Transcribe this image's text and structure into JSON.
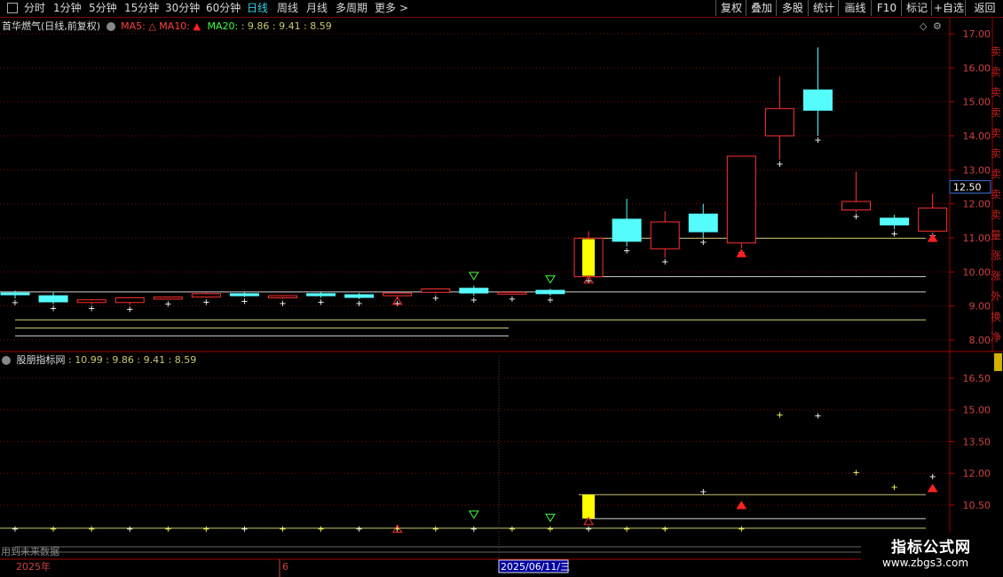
{
  "toolbar": {
    "periods": [
      "分时",
      "1分钟",
      "5分钟",
      "15分钟",
      "30分钟",
      "60分钟",
      "日线",
      "周线",
      "月线",
      "多周期",
      "更多"
    ],
    "active_period": "日线",
    "more_arrow": ">",
    "right_buttons": [
      "复权",
      "叠加",
      "多股",
      "统计",
      "画线",
      "F10",
      "标记",
      "+自选",
      "返回"
    ]
  },
  "main_panel": {
    "stock_title": "首华燃气(日线,前复权)",
    "ma5_label": "MA5:",
    "ma10_label": "MA10:",
    "ma20_label": "MA20:",
    "ma20_values": ": 9.86 : 9.41 : 8.59",
    "price_marker": "12.50",
    "y_ticks": [
      "17.00",
      "16.00",
      "15.00",
      "14.00",
      "13.00",
      "12.00",
      "11.00",
      "10.00",
      "9.00",
      "8.00"
    ],
    "right_strip_text": "卖卖卖卖卖卖卖卖卖量涨涨外换净"
  },
  "sub_panel": {
    "title": "股朋指标网",
    "values": ": 10.99 : 9.86 : 9.41 : 8.59",
    "y_ticks": [
      "16.50",
      "15.00",
      "13.50",
      "12.00",
      "10.50"
    ],
    "note": "用到未来数据"
  },
  "date_axis": {
    "year_label": "2025年",
    "month_label": "6",
    "selected_date": "2025/06/11/三"
  },
  "watermark": {
    "line1": "指标公式网",
    "line2": "www.zbgs3.com"
  },
  "colors": {
    "up": "#ff3030",
    "down": "#54fcfc",
    "highlight": "#ffff00",
    "grid": "#800000",
    "ma_line": "#c8c870",
    "axis_text": "#d04040"
  },
  "chart_data": {
    "type": "candlestick",
    "y_range": [
      7.8,
      17.4
    ],
    "candles": [
      {
        "o": 9.38,
        "c": 9.33,
        "h": 9.45,
        "l": 9.22,
        "dir": "down"
      },
      {
        "o": 9.3,
        "c": 9.12,
        "h": 9.4,
        "l": 9.05,
        "dir": "down"
      },
      {
        "o": 9.1,
        "c": 9.18,
        "h": 9.2,
        "l": 9.05,
        "dir": "up"
      },
      {
        "o": 9.1,
        "c": 9.24,
        "h": 9.26,
        "l": 9.03,
        "dir": "up"
      },
      {
        "o": 9.2,
        "c": 9.26,
        "h": 9.28,
        "l": 9.18,
        "dir": "up"
      },
      {
        "o": 9.26,
        "c": 9.36,
        "h": 9.4,
        "l": 9.24,
        "dir": "up"
      },
      {
        "o": 9.36,
        "c": 9.3,
        "h": 9.4,
        "l": 9.26,
        "dir": "down"
      },
      {
        "o": 9.24,
        "c": 9.3,
        "h": 9.32,
        "l": 9.2,
        "dir": "up"
      },
      {
        "o": 9.36,
        "c": 9.3,
        "h": 9.4,
        "l": 9.24,
        "dir": "down"
      },
      {
        "o": 9.33,
        "c": 9.25,
        "h": 9.38,
        "l": 9.2,
        "dir": "down"
      },
      {
        "o": 9.3,
        "c": 9.38,
        "h": 9.4,
        "l": 9.2,
        "dir": "up"
      },
      {
        "o": 9.4,
        "c": 9.5,
        "h": 9.52,
        "l": 9.36,
        "dir": "up"
      },
      {
        "o": 9.52,
        "c": 9.38,
        "h": 9.6,
        "l": 9.3,
        "dir": "down"
      },
      {
        "o": 9.38,
        "c": 9.4,
        "h": 9.44,
        "l": 9.33,
        "dir": "up"
      },
      {
        "o": 9.46,
        "c": 9.36,
        "h": 9.5,
        "l": 9.3,
        "dir": "down"
      },
      {
        "o": 9.86,
        "c": 10.99,
        "h": 11.2,
        "l": 9.86,
        "dir": "up",
        "highlight": true
      },
      {
        "o": 11.55,
        "c": 10.9,
        "h": 12.15,
        "l": 10.75,
        "dir": "down"
      },
      {
        "o": 10.68,
        "c": 11.47,
        "h": 11.78,
        "l": 10.42,
        "dir": "up"
      },
      {
        "o": 11.7,
        "c": 11.18,
        "h": 12.0,
        "l": 11.0,
        "dir": "down"
      },
      {
        "o": 10.85,
        "c": 13.4,
        "h": 13.4,
        "l": 10.7,
        "dir": "up"
      },
      {
        "o": 14.0,
        "c": 14.8,
        "h": 15.75,
        "l": 13.3,
        "dir": "up"
      },
      {
        "o": 15.35,
        "c": 14.75,
        "h": 16.6,
        "l": 14.0,
        "dir": "down"
      },
      {
        "o": 11.82,
        "c": 12.07,
        "h": 12.95,
        "l": 11.75,
        "dir": "up"
      },
      {
        "o": 11.58,
        "c": 11.38,
        "h": 11.68,
        "l": 11.25,
        "dir": "down"
      },
      {
        "o": 11.2,
        "c": 11.88,
        "h": 12.3,
        "l": 11.2,
        "dir": "up"
      }
    ],
    "levels_main": [
      10.99,
      9.86,
      9.41,
      8.59,
      8.35,
      8.12
    ],
    "sub_y_range": [
      9.0,
      17.5
    ],
    "sub_levels": [
      10.99,
      9.86,
      9.41
    ]
  }
}
